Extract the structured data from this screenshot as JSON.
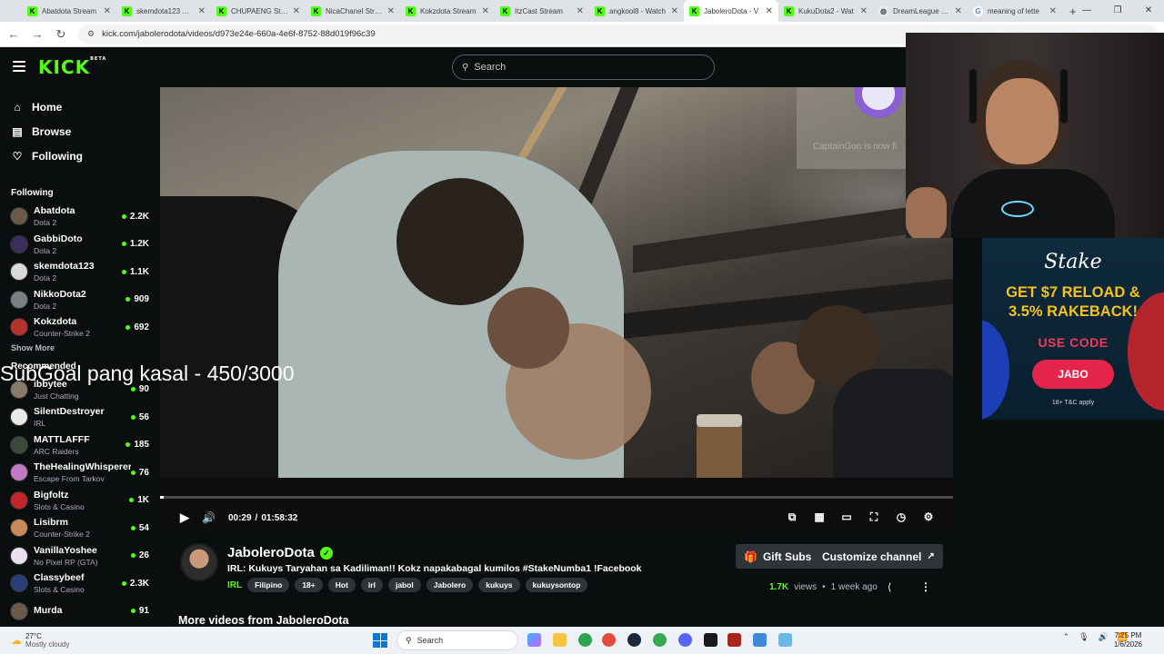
{
  "browser": {
    "tabs": [
      {
        "label": "Abatdota Stream",
        "icon": "kick"
      },
      {
        "label": "skemdota123 Stream",
        "icon": "kick"
      },
      {
        "label": "CHUPAENG Stream",
        "icon": "kick"
      },
      {
        "label": "NicaChanel Stream",
        "icon": "kick"
      },
      {
        "label": "Kokzdota Stream",
        "icon": "kick"
      },
      {
        "label": "ItzCast Stream",
        "icon": "kick"
      },
      {
        "label": "angkool8 - Watch",
        "icon": "kick"
      },
      {
        "label": "JaboleroDota - V",
        "icon": "kick",
        "active": true
      },
      {
        "label": "KukuDota2 - Wat",
        "icon": "kick"
      },
      {
        "label": "DreamLeague Se",
        "icon": "web"
      },
      {
        "label": "meaning of lette",
        "icon": "google"
      }
    ],
    "new_tab": "+",
    "url": "kick.com/jabolerodota/videos/d973e24e-660a-4e6f-8752-88d019f96c39"
  },
  "header": {
    "logo": "KICK",
    "logo_badge": "BETA",
    "search_placeholder": "Search"
  },
  "sidebar": {
    "nav": [
      {
        "label": "Home",
        "icon": "home-icon"
      },
      {
        "label": "Browse",
        "icon": "browse-icon"
      },
      {
        "label": "Following",
        "icon": "heart-icon"
      }
    ],
    "following_title": "Following",
    "following": [
      {
        "name": "Abatdota",
        "category": "Dota 2",
        "viewers": "2.2K",
        "color": "#6b5a4a"
      },
      {
        "name": "GabbiDoto",
        "category": "Dota 2",
        "viewers": "1.2K",
        "color": "#3a2f5a"
      },
      {
        "name": "skemdota123",
        "category": "Dota 2",
        "viewers": "1.1K",
        "color": "#d9d9d9"
      },
      {
        "name": "NikkoDota2",
        "category": "Dota 2",
        "viewers": "909",
        "color": "#7a7f86"
      },
      {
        "name": "Kokzdota",
        "category": "Counter-Strike 2",
        "viewers": "692",
        "color": "#b5332e"
      }
    ],
    "show_more": "Show More",
    "recommended_title": "Recommended",
    "recommended": [
      {
        "name": "ibbytee",
        "category": "Just Chatting",
        "viewers": "90",
        "color": "#8a7a6a"
      },
      {
        "name": "SilentDestroyer",
        "category": "IRL",
        "viewers": "56",
        "color": "#e8e8e8"
      },
      {
        "name": "MATTLAFFF",
        "category": "ARC Raiders",
        "viewers": "185",
        "color": "#3b4a3b"
      },
      {
        "name": "TheHealingWhisperer",
        "category": "Escape From Tarkov",
        "viewers": "76",
        "color": "#c27ac7"
      },
      {
        "name": "Bigfoltz",
        "category": "Slots & Casino",
        "viewers": "1K",
        "color": "#c4242c"
      },
      {
        "name": "Lisibrm",
        "category": "Counter-Strike 2",
        "viewers": "54",
        "color": "#c98a5a"
      },
      {
        "name": "VanillaYoshee",
        "category": "No Pixel RP (GTA)",
        "viewers": "26",
        "color": "#e8e0f0"
      },
      {
        "name": "Classybeef",
        "category": "Slots & Casino",
        "viewers": "2.3K",
        "color": "#2a3f7a"
      },
      {
        "name": "Murda",
        "category": "",
        "viewers": "91",
        "color": "#6a5a4a"
      }
    ]
  },
  "player": {
    "current_time": "00:29",
    "separator": "/",
    "duration": "01:58:32",
    "progress_fraction": 0.004,
    "watermark": "CaptainGoo is now fi",
    "overlay_text": "SubGoal pang kasal - 450/3000"
  },
  "webcam": {},
  "ad": {
    "brand": "Stake",
    "headline_line1": "GET $7 RELOAD &",
    "headline_line2": "3.5% RAKEBACK!",
    "use_code": "USE CODE",
    "code": "JABO",
    "fine_print": "18+ T&C apply"
  },
  "video_info": {
    "streamer": "JaboleroDota",
    "title": "IRL: Kukuys Taryahan sa Kadiliman!! Kokz napakabagal kumilos #StakeNumba1 !Facebook",
    "category": "IRL",
    "tags": [
      "Filipino",
      "18+",
      "Hot",
      "irl",
      "jabol",
      "Jabolero",
      "kukuys",
      "kukuysontop"
    ],
    "gift_label": "Gift Subs",
    "customize_label": "Customize channel",
    "views": "1.7K",
    "views_label": "views",
    "bullet": "•",
    "age": "1 week ago",
    "more_videos": "More videos from JaboleroDota"
  },
  "taskbar": {
    "temperature": "27°C",
    "weather": "Mostly cloudy",
    "search": "Search",
    "time": "7:25 PM",
    "date": "1/6/2026"
  },
  "colors": {
    "kick_green": "#53fc18",
    "background": "#0b0e0f",
    "button_gray": "#2f3437",
    "stake_red": "#e5254c",
    "stake_yellow": "#f4c21b"
  }
}
